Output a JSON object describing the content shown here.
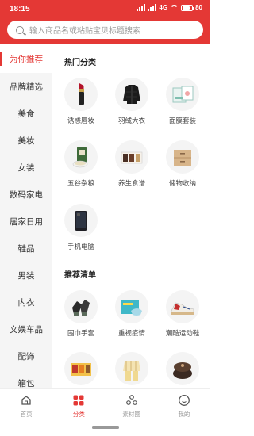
{
  "status_bar": {
    "time": "18:15",
    "network": "4G",
    "battery": "80"
  },
  "search": {
    "placeholder": "输入商品名或粘贴宝贝标题搜索"
  },
  "left_nav": [
    {
      "label": "为你推荐",
      "active": true
    },
    {
      "label": "品牌精选"
    },
    {
      "label": "美食"
    },
    {
      "label": "美妆"
    },
    {
      "label": "女装"
    },
    {
      "label": "数码家电"
    },
    {
      "label": "居家日用"
    },
    {
      "label": "鞋品"
    },
    {
      "label": "男装"
    },
    {
      "label": "内衣"
    },
    {
      "label": "文娱车品"
    },
    {
      "label": "配饰"
    },
    {
      "label": "箱包"
    }
  ],
  "hot_categories": {
    "title": "热门分类",
    "items": [
      {
        "label": "诱惑唇妆",
        "icon": "lipstick-icon"
      },
      {
        "label": "羽绒大衣",
        "icon": "down-jacket-icon"
      },
      {
        "label": "面膜套装",
        "icon": "face-mask-icon"
      },
      {
        "label": "五谷杂粮",
        "icon": "grain-icon"
      },
      {
        "label": "养生食谱",
        "icon": "tea-gift-box-icon"
      },
      {
        "label": "储物收纳",
        "icon": "storage-drawer-icon"
      },
      {
        "label": "手机电脑",
        "icon": "phone-icon"
      }
    ]
  },
  "recommended": {
    "title": "推荐清单",
    "items": [
      {
        "label": "围巾手套",
        "icon": "gloves-icon"
      },
      {
        "label": "重视疫情",
        "icon": "mask-box-icon"
      },
      {
        "label": "潮酷运动鞋",
        "icon": "sneaker-icon"
      },
      {
        "label": "",
        "icon": "snack-box-icon"
      },
      {
        "label": "",
        "icon": "pajamas-icon"
      },
      {
        "label": "",
        "icon": "rice-cooker-icon"
      }
    ]
  },
  "tab_bar": [
    {
      "label": "首页",
      "icon": "home-icon"
    },
    {
      "label": "分类",
      "icon": "category-grid-icon",
      "active": true
    },
    {
      "label": "素材圈",
      "icon": "material-circle-icon"
    },
    {
      "label": "我的",
      "icon": "profile-icon"
    }
  ],
  "colors": {
    "brand_red": "#e43835",
    "nav_bg": "#f5f5f5",
    "tab_inactive": "#999999"
  }
}
